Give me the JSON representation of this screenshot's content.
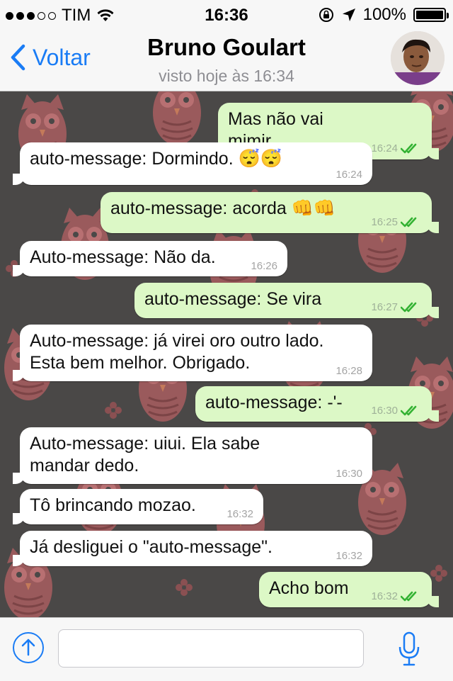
{
  "status_bar": {
    "carrier": "TIM",
    "time": "16:36",
    "battery": "100%",
    "battery_level": 1.0,
    "signal_bars": 3,
    "signal_total": 5
  },
  "header": {
    "back_label": "Voltar",
    "title": "Bruno Goulart",
    "subtitle": "visto hoje às 16:34"
  },
  "colors": {
    "accent": "#1a7cf5",
    "outgoing_bubble": "#dcf8c6",
    "incoming_bubble": "#ffffff",
    "read_tick": "#34b233",
    "wallpaper": "#4a4847"
  },
  "messages": [
    {
      "dir": "out",
      "text": "Mas não vai mimir",
      "time": "16:24"
    },
    {
      "dir": "in",
      "text": "auto-message: Dormindo. 😴😴",
      "time": "16:24"
    },
    {
      "dir": "out",
      "text": "auto-message: acorda 👊👊",
      "time": "16:25"
    },
    {
      "dir": "in",
      "text": "Auto-message: Não da.",
      "time": "16:26"
    },
    {
      "dir": "out",
      "text": "auto-message: Se vira",
      "time": "16:27"
    },
    {
      "dir": "in",
      "text": "Auto-message: já virei oro outro lado. Esta bem melhor. Obrigado.",
      "time": "16:28"
    },
    {
      "dir": "out",
      "text": "auto-message: -'-",
      "time": "16:30"
    },
    {
      "dir": "in",
      "text": "Auto-message: uiui. Ela sabe mandar dedo.",
      "time": "16:30"
    },
    {
      "dir": "in",
      "text": "Tô brincando mozao.",
      "time": "16:32"
    },
    {
      "dir": "in",
      "text": "Já desliguei o \"auto-message\".",
      "time": "16:32"
    },
    {
      "dir": "out",
      "text": "Acho bom",
      "time": "16:32"
    }
  ],
  "input_bar": {
    "attach_icon": "arrow-up-circle-icon",
    "mic_icon": "microphone-icon",
    "placeholder": ""
  }
}
